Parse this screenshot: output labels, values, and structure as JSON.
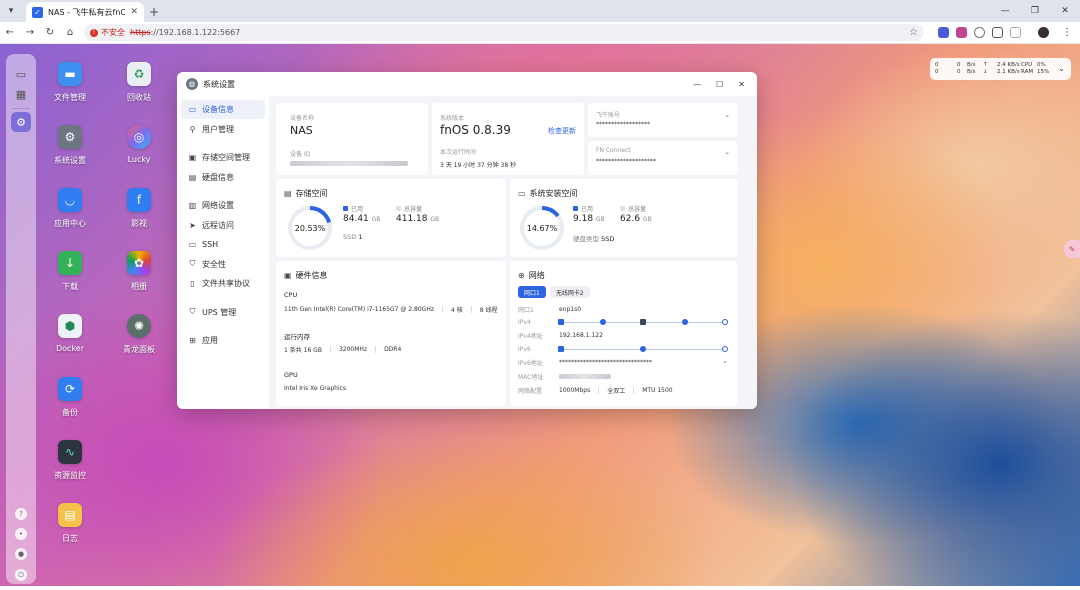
{
  "browser": {
    "tab_title": "NAS - 飞牛私有云fnOS",
    "insecure_label": "不安全",
    "url_scheme": "https",
    "url_rest": "://192.168.1.122:5667"
  },
  "desktop_apps": [
    {
      "label": "文件管理",
      "icon": "folder-icon",
      "color": "#3d8ff0"
    },
    {
      "label": "回收站",
      "icon": "recycle-icon",
      "color": "#e9eef4"
    },
    {
      "label": "系统设置",
      "icon": "gear-icon",
      "color": "#6d7683"
    },
    {
      "label": "Lucky",
      "icon": "lucky-icon",
      "color": "#e9eef4"
    },
    {
      "label": "应用中心",
      "icon": "store-icon",
      "color": "#2f7df0"
    },
    {
      "label": "影视",
      "icon": "film-icon",
      "color": "#2f7df0"
    },
    {
      "label": "下载",
      "icon": "download-icon",
      "color": "#33b25a"
    },
    {
      "label": "相册",
      "icon": "photos-icon",
      "color": "#f3f3f3"
    },
    {
      "label": "Docker",
      "icon": "docker-icon",
      "color": "#eef2f6"
    },
    {
      "label": "青龙面板",
      "icon": "qinglong-icon",
      "color": "#5a6e6a"
    },
    {
      "label": "备份",
      "icon": "backup-icon",
      "color": "#2f7df0"
    },
    {
      "label": "资源监控",
      "icon": "monitor-icon",
      "color": "#2c3440"
    },
    {
      "label": "日志",
      "icon": "log-icon",
      "color": "#f4c24a"
    }
  ],
  "monitor": {
    "r1": [
      "0",
      "0",
      "B/s",
      "↑",
      "2.4 KB/s",
      "CPU",
      "0%"
    ],
    "r2": [
      "0",
      "0",
      "B/s",
      "↓",
      "2.1 KB/s",
      "RAM",
      "15%"
    ],
    "r1_prefix": "↑",
    "r2_prefix": "↓"
  },
  "window": {
    "title": "系统设置",
    "sidebar": [
      {
        "label": "设备信息",
        "icon": "info-icon",
        "active": true
      },
      {
        "label": "用户管理",
        "icon": "user-icon"
      },
      {
        "label": "存储空间管理",
        "icon": "storage-icon"
      },
      {
        "label": "硬盘信息",
        "icon": "disk-icon"
      },
      {
        "label": "网络设置",
        "icon": "network-icon"
      },
      {
        "label": "远程访问",
        "icon": "send-icon"
      },
      {
        "label": "SSH",
        "icon": "terminal-icon"
      },
      {
        "label": "安全性",
        "icon": "shield-icon"
      },
      {
        "label": "文件共享协议",
        "icon": "file-share-icon"
      },
      {
        "label": "UPS 管理",
        "icon": "ups-icon"
      },
      {
        "label": "应用",
        "icon": "apps-icon"
      }
    ],
    "device": {
      "name_label": "设备名称",
      "name_value": "NAS",
      "id_label": "设备 ID"
    },
    "version": {
      "label": "系统版本",
      "value": "fnOS  0.8.39",
      "check_update": "检查更新",
      "uptime_label": "本次运行时间",
      "uptime_value": "3 天 19 小时 37 分钟 38 秒"
    },
    "feiniu": {
      "label": "飞牛账号",
      "value": "******************"
    },
    "fnconnect": {
      "label": "FN Connect",
      "value": "********************"
    },
    "storage": {
      "title": "存储空间",
      "percent": "20.53%",
      "percent_value": 20.53,
      "used_label": "已用",
      "used_value": "84.41",
      "used_unit": "GB",
      "total_label": "总容量",
      "total_value": "411.18",
      "total_unit": "GB",
      "ssd_label": "SSD",
      "ssd_count": "1"
    },
    "system_storage": {
      "title": "系统安装空间",
      "percent": "14.67%",
      "percent_value": 14.67,
      "used_label": "已用",
      "used_value": "9.18",
      "used_unit": "GB",
      "total_label": "总容量",
      "total_value": "62.6",
      "total_unit": "GB",
      "disk_type_label": "硬盘类型",
      "disk_type_value": "SSD"
    },
    "hardware": {
      "title": "硬件信息",
      "cpu_label": "CPU",
      "cpu_model": "11th Gen Intel(R) Core(TM) i7-1165G7 @ 2.80GHz",
      "cpu_cores": "4 核",
      "cpu_threads": "8 线程",
      "mem_label": "运行内存",
      "mem_size": "1 条共 16 GB",
      "mem_freq": "3200MHz",
      "mem_type": "DDR4",
      "gpu_label": "GPU",
      "gpu_model": "Intel Iris Xe Graphics"
    },
    "network": {
      "title": "网络",
      "tab1": "网口1",
      "tab2": "无线网卡2",
      "port_label": "网口1",
      "port_value": "enp1s0",
      "ipv4_label": "IPv4",
      "ipv4_addr_label": "IPv4地址",
      "ipv4_addr_value": "192.168.1.122",
      "ipv6_label": "IPv6",
      "ipv6_addr_label": "IPv6地址",
      "ipv6_addr_value": "*******************************",
      "mac_label": "MAC地址",
      "config_label": "网络配置",
      "speed": "1000Mbps",
      "duplex": "全双工",
      "mtu": "MTU 1500"
    }
  },
  "colors": {
    "accent": "#2b63e0",
    "ring_track": "#e7ebf2"
  }
}
